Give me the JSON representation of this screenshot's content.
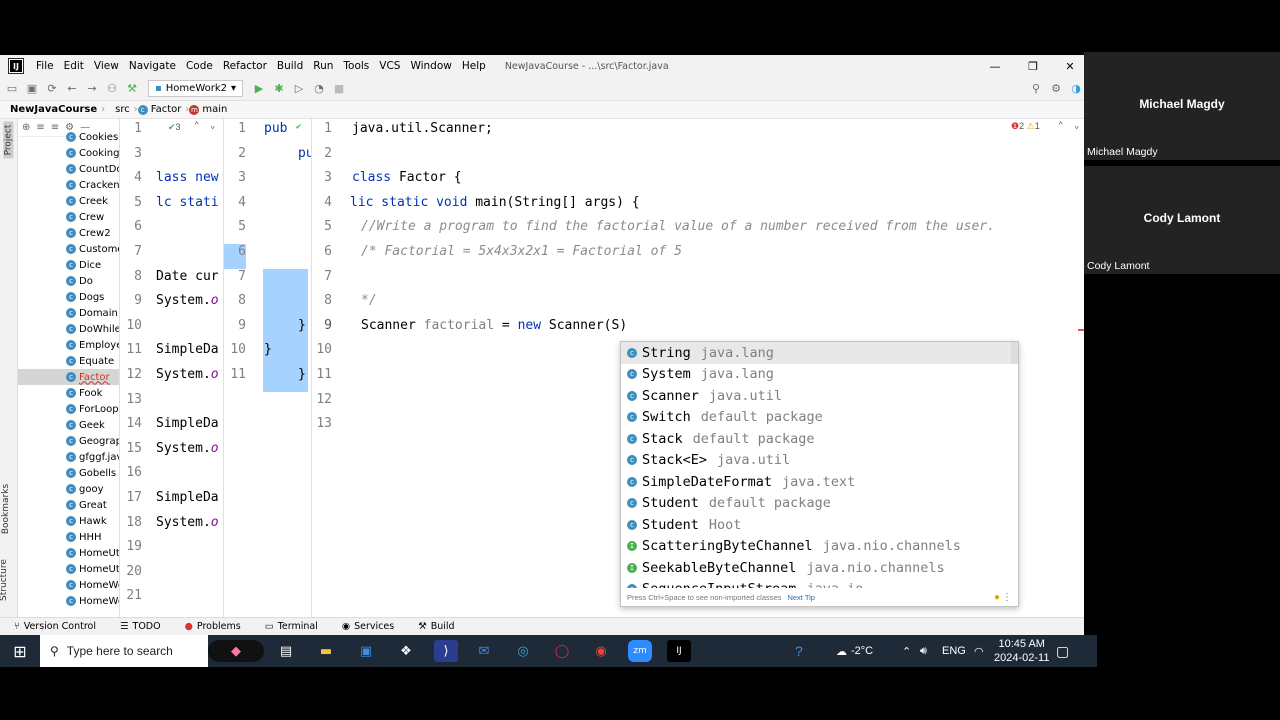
{
  "ide": {
    "menu": [
      "File",
      "Edit",
      "View",
      "Navigate",
      "Code",
      "Refactor",
      "Build",
      "Run",
      "Tools",
      "VCS",
      "Window",
      "Help"
    ],
    "window_title": "NewJavaCourse - ...\\src\\Factor.java",
    "app_icon": "IJ",
    "run_config": "HomeWork2",
    "breadcrumb": [
      "NewJavaCourse",
      "src",
      "Factor",
      "main"
    ],
    "left_strip": {
      "project": "Project",
      "bookmarks": "Bookmarks",
      "structure": "Structure"
    },
    "project_files": [
      "Cookies.j",
      "Cooking",
      "CountDov",
      "Cracken",
      "Creek",
      "Crew",
      "Crew2",
      "Customer",
      "Dice",
      "Do",
      "Dogs",
      "Domain",
      "DoWhile",
      "Employee",
      "Equate",
      "Factor",
      "Fook",
      "ForLoop",
      "Geek",
      "Geograph",
      "gfggf.java",
      "Gobells",
      "gooy",
      "Great",
      "Hawk",
      "HHH",
      "HomeUtil",
      "HomeUti",
      "HomeWo",
      "HomeWo"
    ],
    "selected_file": "Factor",
    "pane1": {
      "check_count": "3",
      "line_numbers": [
        "1",
        "3",
        "4",
        "5",
        "6",
        "7",
        "8",
        "9",
        "10",
        "11",
        "12",
        "13",
        "14",
        "15",
        "16",
        "17",
        "18",
        "19",
        "20",
        "21"
      ],
      "lines": [
        "",
        "",
        "lass new",
        "lc stati",
        "",
        "",
        "Date cur",
        "System.o",
        "",
        "SimpleDa",
        "System.o",
        "",
        "SimpleDa",
        "System.o",
        "",
        "SimpleDa",
        "System.o",
        "",
        "",
        ""
      ]
    },
    "pane2": {
      "line_numbers": [
        "1",
        "2",
        "3",
        "4",
        "5",
        "6",
        "7",
        "8",
        "9",
        "10",
        "11"
      ],
      "lines": [
        "pub",
        "pu",
        "",
        "",
        "",
        "",
        "",
        "",
        "}",
        "}",
        "}"
      ]
    },
    "pane3": {
      "error_count": "2",
      "warning_count": "1",
      "line_numbers": [
        "1",
        "2",
        "3",
        "4",
        "5",
        "6",
        "7",
        "8",
        "9",
        "10",
        "11",
        "12",
        "13"
      ],
      "import_line": "java.util.Scanner;",
      "class_kw": "class",
      "class_name": "Factor {",
      "main_kw": "lic static void",
      "main_sig": "main(String[] args) {",
      "comment1": "//Write a program to find the factorial value of a number received from the user.",
      "comment2": "/* Factorial = 5x4x3x2x1 = Factorial of 5",
      "comment3": "*/",
      "scanner_type": "Scanner",
      "scanner_var": "factorial",
      "scanner_eq": "=",
      "scanner_new": "new",
      "scanner_call": "Scanner(S)"
    },
    "autocomplete": {
      "items": [
        {
          "name": "String",
          "pkg": "java.lang",
          "kind": "class"
        },
        {
          "name": "System",
          "pkg": "java.lang",
          "kind": "class"
        },
        {
          "name": "Scanner",
          "pkg": "java.util",
          "kind": "class"
        },
        {
          "name": "Switch",
          "pkg": "default package",
          "kind": "class"
        },
        {
          "name": "Stack",
          "pkg": "default package",
          "kind": "class"
        },
        {
          "name": "Stack<E>",
          "pkg": "java.util",
          "kind": "class"
        },
        {
          "name": "SimpleDateFormat",
          "pkg": "java.text",
          "kind": "class"
        },
        {
          "name": "Student",
          "pkg": "default package",
          "kind": "class"
        },
        {
          "name": "Student",
          "pkg": "Hoot",
          "kind": "class"
        },
        {
          "name": "ScatteringByteChannel",
          "pkg": "java.nio.channels",
          "kind": "interface"
        },
        {
          "name": "SeekableByteChannel",
          "pkg": "java.nio.channels",
          "kind": "interface"
        },
        {
          "name": "SequenceInputStream",
          "pkg": "java.io",
          "kind": "class"
        }
      ],
      "footer_hint": "Press Ctrl+Space to see non-imported classes",
      "next_tip": "Next Tip"
    },
    "bottom_tabs": [
      "Version Control",
      "TODO",
      "Problems",
      "Terminal",
      "Services",
      "Build"
    ]
  },
  "participants": [
    {
      "name": "Michael Magdy",
      "tag": "Michael Magdy"
    },
    {
      "name": "Cody Lamont",
      "tag": "Cody Lamont"
    }
  ],
  "taskbar": {
    "search_placeholder": "Type here to search",
    "temperature": "-2°C",
    "language": "ENG",
    "time": "10:45 AM",
    "date": "2024-02-11"
  }
}
